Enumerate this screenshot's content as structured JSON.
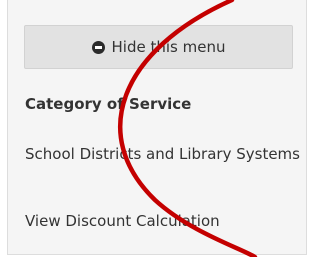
{
  "sidebar": {
    "hide_button_label": "Hide this menu",
    "hide_button_icon": "minus-circle-icon",
    "heading": "Category of Service",
    "items": [
      {
        "label": "School Districts and Library Systems"
      },
      {
        "label": "View Discount Calculation"
      }
    ]
  },
  "annotation": {
    "color": "#c40000",
    "shape": "curved-stroke"
  }
}
